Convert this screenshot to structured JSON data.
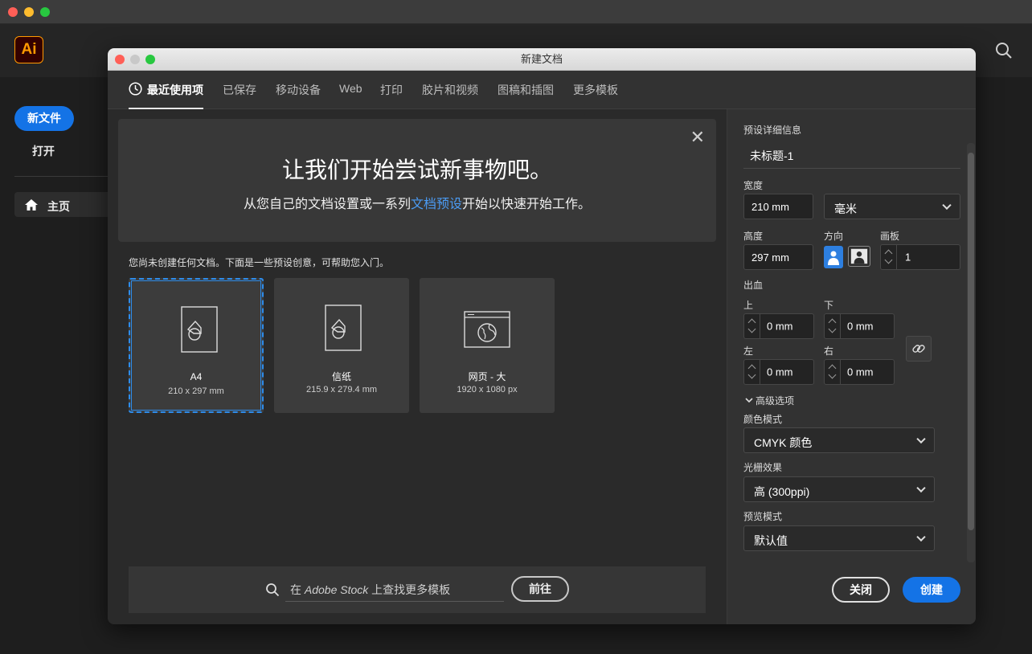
{
  "app": {
    "logo": "Ai",
    "accent": "#1473e6"
  },
  "sidebar": {
    "new_file": "新文件",
    "open": "打开",
    "home": "主页"
  },
  "dialog": {
    "title": "新建文档",
    "tabs": [
      {
        "label": "最近使用项",
        "active": true
      },
      {
        "label": "已保存"
      },
      {
        "label": "移动设备"
      },
      {
        "label": "Web"
      },
      {
        "label": "打印"
      },
      {
        "label": "胶片和视频"
      },
      {
        "label": "图稿和插图"
      },
      {
        "label": "更多模板"
      }
    ],
    "banner": {
      "heading": "让我们开始尝试新事物吧。",
      "sub_before": "从您自己的文档设置或一系列",
      "sub_link": "文档预设",
      "sub_after": "开始以快速开始工作。"
    },
    "hint": "您尚未创建任何文档。下面是一些预设创意，可帮助您入门。",
    "presets": [
      {
        "name": "A4",
        "size": "210 x 297 mm",
        "icon": "document-icon",
        "selected": true
      },
      {
        "name": "信纸",
        "size": "215.9 x 279.4 mm",
        "icon": "document-icon"
      },
      {
        "name": "网页 - 大",
        "size": "1920 x 1080 px",
        "icon": "web-page-icon"
      }
    ],
    "stock": {
      "placeholder_pre": "在 ",
      "placeholder_em": "Adobe Stock",
      "placeholder_post": " 上查找更多模板",
      "go": "前往"
    },
    "details": {
      "section": "预设详细信息",
      "name": "未标题-1",
      "width_label": "宽度",
      "width": "210 mm",
      "unit": "毫米",
      "height_label": "高度",
      "height": "297 mm",
      "orientation_label": "方向",
      "orientation": "portrait",
      "artboards_label": "画板",
      "artboards": "1",
      "bleed_label": "出血",
      "bleed_top_label": "上",
      "bleed_top": "0 mm",
      "bleed_bottom_label": "下",
      "bleed_bottom": "0 mm",
      "bleed_left_label": "左",
      "bleed_left": "0 mm",
      "bleed_right_label": "右",
      "bleed_right": "0 mm",
      "advanced": "高级选项",
      "color_mode_label": "颜色模式",
      "color_mode": "CMYK 颜色",
      "raster_label": "光栅效果",
      "raster": "高 (300ppi)",
      "preview_label": "预览模式",
      "preview": "默认值"
    },
    "buttons": {
      "close": "关闭",
      "create": "创建"
    }
  }
}
